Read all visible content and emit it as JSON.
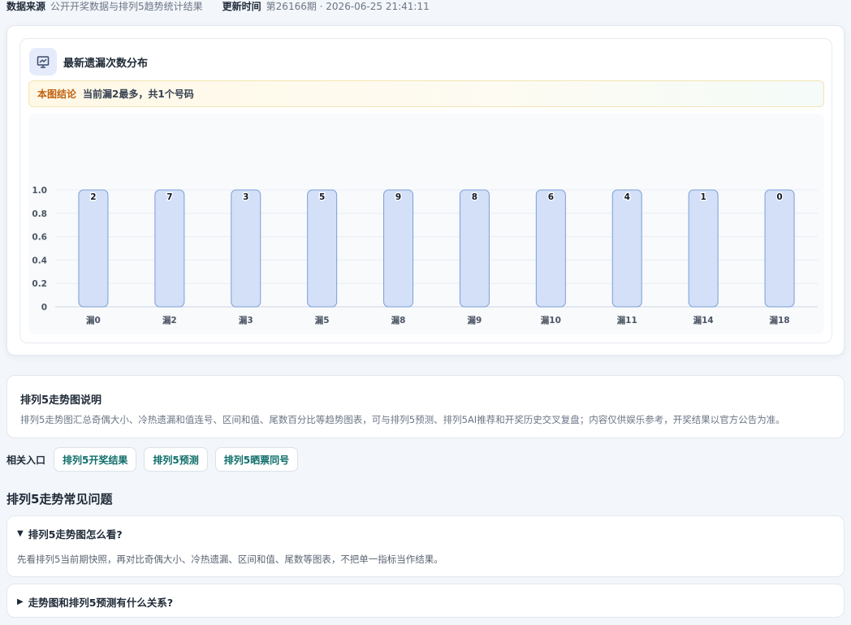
{
  "meta": {
    "source_label": "数据来源",
    "source_value": "公开开奖数据与排列5趋势统计结果",
    "updated_label": "更新时间",
    "updated_value": "第26166期 · 2026-06-25 21:41:11"
  },
  "chart_card": {
    "title": "最新遗漏次数分布",
    "icon": "presentation-chart-icon",
    "conclusion_tag": "本图结论",
    "conclusion_text": "当前漏2最多，共1个号码"
  },
  "chart_data": {
    "type": "bar",
    "categories": [
      "漏0",
      "漏2",
      "漏3",
      "漏5",
      "漏8",
      "漏9",
      "漏10",
      "漏11",
      "漏14",
      "漏18"
    ],
    "values": [
      1,
      1,
      1,
      1,
      1,
      1,
      1,
      1,
      1,
      1
    ],
    "bar_labels": [
      "2",
      "7",
      "3",
      "5",
      "9",
      "8",
      "6",
      "4",
      "1",
      "0"
    ],
    "yticks": [
      "0",
      "0.2",
      "0.4",
      "0.6",
      "0.8",
      "1.0"
    ],
    "ylim": [
      0,
      1
    ],
    "grid": true,
    "bar_color": "#d3e0f8",
    "bar_border": "#7b9fd6"
  },
  "description": {
    "title": "排列5走势图说明",
    "text": "排列5走势图汇总奇偶大小、冷热遗漏和值连号、区间和值、尾数百分比等趋势图表，可与排列5预测、排列5AI推荐和开奖历史交叉复盘；内容仅供娱乐参考，开奖结果以官方公告为准。"
  },
  "related": {
    "label": "相关入口",
    "links": [
      "排列5开奖结果",
      "排列5预测",
      "排列5晒票同号"
    ]
  },
  "faq": {
    "heading": "排列5走势常见问题",
    "items": [
      {
        "marker": "▼",
        "question": "排列5走势图怎么看?",
        "answer": "先看排列5当前期快照，再对比奇偶大小、冷热遗漏、区间和值、尾数等图表，不把单一指标当作结果。"
      },
      {
        "marker": "▶",
        "question": "走势图和排列5预测有什么关系?"
      }
    ]
  },
  "colors": {
    "accent_teal": "#0f6e6a",
    "conclusion_orange": "#c0620f",
    "icon_bg": "#e5ebfb"
  }
}
